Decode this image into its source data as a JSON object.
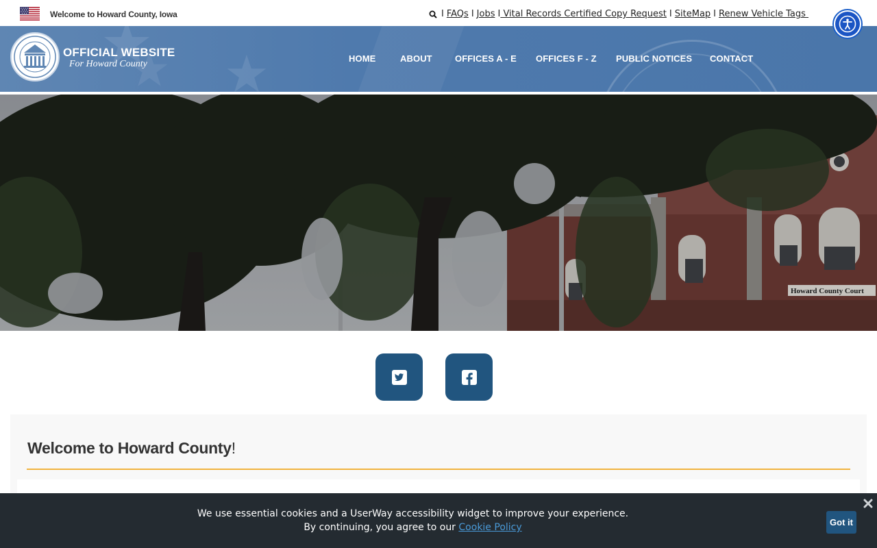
{
  "topbar": {
    "welcome": "Welcome to Howard County, Iowa",
    "links": [
      {
        "label": "FAQs"
      },
      {
        "label": "Jobs"
      },
      {
        "label": " Vital Records Certified Copy Request"
      },
      {
        "label": "SiteMap"
      },
      {
        "label": "Renew Vehicle Tags "
      }
    ],
    "separator": "I"
  },
  "header": {
    "logo_title": "OFFICIAL WEBSITE",
    "logo_subtitle": "For Howard County",
    "nav": [
      "HOME",
      "ABOUT",
      "OFFICES A - E",
      "OFFICES F - Z",
      "PUBLIC NOTICES",
      "CONTACT"
    ]
  },
  "hero": {
    "sign_text": "Howard County Court"
  },
  "social": [
    {
      "icon": "twitter-icon"
    },
    {
      "icon": "facebook-icon"
    }
  ],
  "welcome_panel": {
    "title": "Welcome to Howard County",
    "title_suffix": "!"
  },
  "cookie_banner": {
    "line1": "We use essential cookies and a UserWay accessibility widget to improve your experience.",
    "line2_prefix": "By continuing, you agree to our ",
    "policy_link": "Cookie Policy",
    "button": "Got it"
  },
  "colors": {
    "header_blue": "#4f7aad",
    "social_blue": "#21557f",
    "accent_rule": "#f1b33e",
    "cookie_bg": "#242b31",
    "a11y_blue": "#1b55c4"
  }
}
